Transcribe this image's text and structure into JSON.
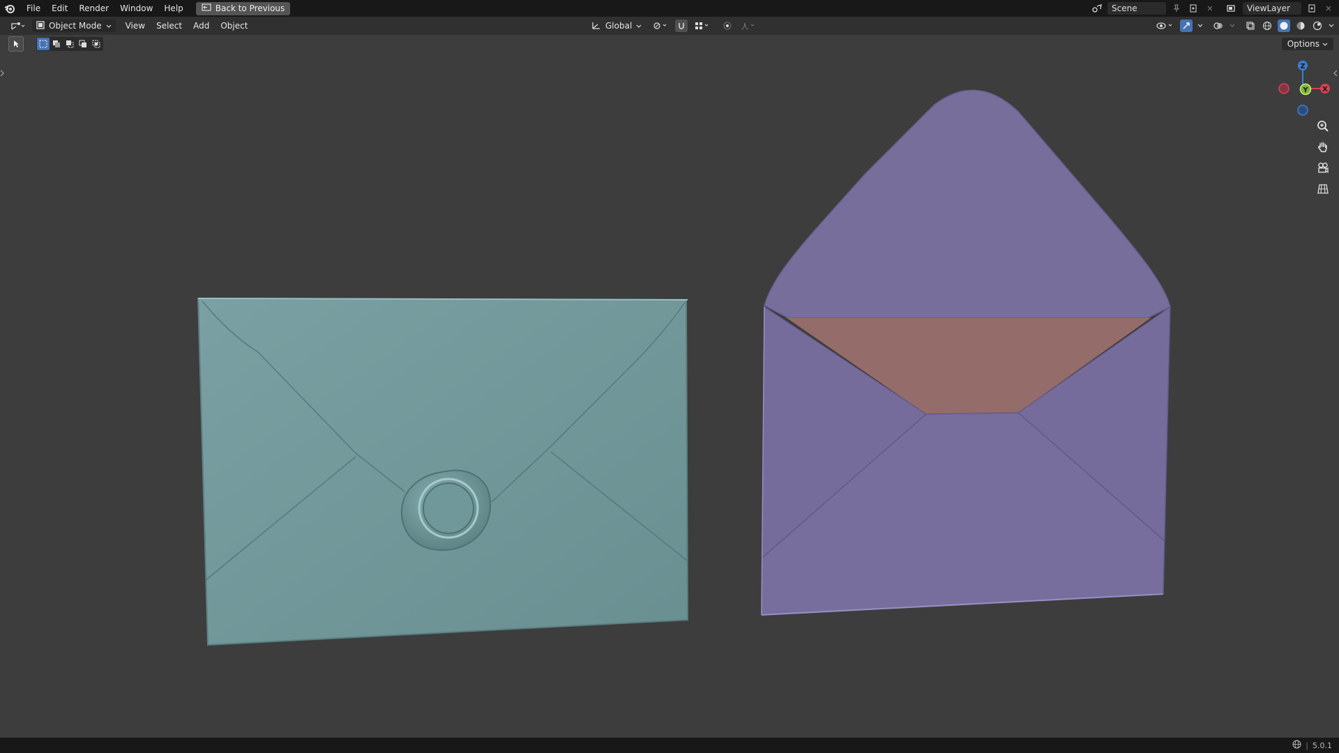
{
  "topbar": {
    "menus": [
      "File",
      "Edit",
      "Render",
      "Window",
      "Help"
    ],
    "back_label": "Back to Previous",
    "scene_name": "Scene",
    "view_layer": "ViewLayer"
  },
  "header": {
    "mode": "Object Mode",
    "menus": [
      "View",
      "Select",
      "Add",
      "Object"
    ],
    "transform_orientation": "Global"
  },
  "viewport": {
    "options_label": "Options",
    "gizmo": {
      "x_label": "X",
      "y_label": "Y",
      "z_label": "Z"
    },
    "colors": {
      "closed_envelope": "#6e9597",
      "open_envelope": "#78709a",
      "envelope_lining": "#946c6a",
      "background": "#3d3d3d"
    }
  },
  "status": {
    "version": "5.0.1"
  }
}
